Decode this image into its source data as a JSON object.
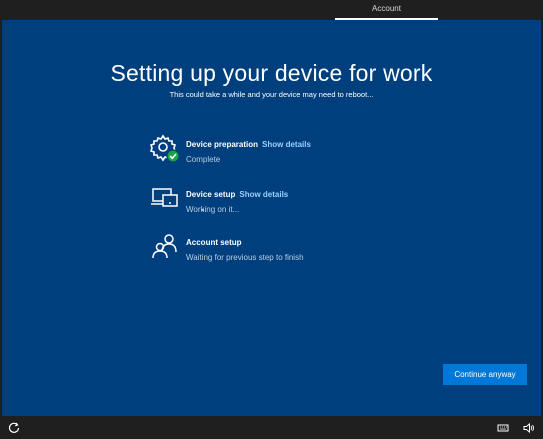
{
  "topbar": {
    "tab_label": "Account"
  },
  "main": {
    "title": "Setting up your device for work",
    "subtitle": "This could take a while and your device may need to reboot..."
  },
  "steps": [
    {
      "name": "Device preparation",
      "link": "Show details",
      "status": "Complete",
      "icon": "gear-check-icon"
    },
    {
      "name": "Device setup",
      "link": "Show details",
      "status": "Working on it...",
      "icon": "devices-icon"
    },
    {
      "name": "Account setup",
      "link": "",
      "status": "Waiting for previous step to finish",
      "icon": "users-icon"
    }
  ],
  "footer": {
    "continue_label": "Continue anyway"
  },
  "taskbar": {
    "left_icon": "ease-of-access-icon",
    "right_icons": [
      "keyboard-icon",
      "volume-icon"
    ]
  },
  "colors": {
    "background": "#003f7d",
    "accent": "#0078d7",
    "link": "#99d1ff",
    "check": "#16a34a",
    "chrome": "#1f1f1f"
  }
}
